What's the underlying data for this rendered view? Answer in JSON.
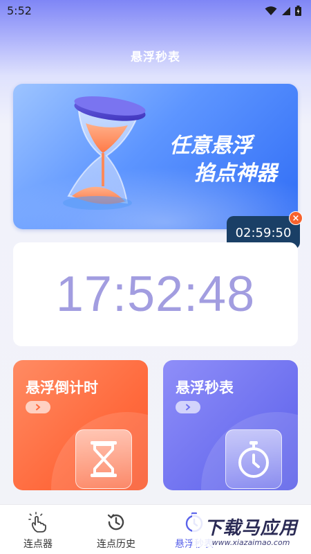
{
  "status_bar": {
    "time": "5:52",
    "icons": [
      "wifi-icon",
      "signal-icon",
      "battery-icon"
    ]
  },
  "header": {
    "title": "悬浮秒表"
  },
  "banner": {
    "line1": "任意悬浮",
    "line2": "掐点神器",
    "icon": "hourglass-icon"
  },
  "floating_timer": {
    "value": "02:59:50",
    "close_icon": "close-icon"
  },
  "clock": {
    "time": "17:52:48"
  },
  "cards": [
    {
      "title": "悬浮倒计时",
      "icon": "hourglass-icon",
      "arrow_icon": "chevron-right-icon",
      "color": "#ff6a3d"
    },
    {
      "title": "悬浮秒表",
      "icon": "stopwatch-icon",
      "arrow_icon": "chevron-right-icon",
      "color": "#6f72f0"
    }
  ],
  "bottom_nav": {
    "items": [
      {
        "label": "连点器",
        "icon": "tap-icon"
      },
      {
        "label": "连点历史",
        "icon": "history-icon"
      },
      {
        "label": "悬浮秒表",
        "icon": "stopwatch-nav-icon",
        "active": true
      },
      {
        "label": "",
        "icon": "more-icon"
      }
    ]
  },
  "watermark": {
    "cn": "下载马应用",
    "en": "www.xiazaimao.com"
  },
  "colors": {
    "accent": "#5a63ea",
    "countdown_card": "#ff6a3d",
    "stopwatch_card": "#6f72f0",
    "float_timer_bg": "#1a3f66",
    "clock_text": "#a29de0"
  }
}
